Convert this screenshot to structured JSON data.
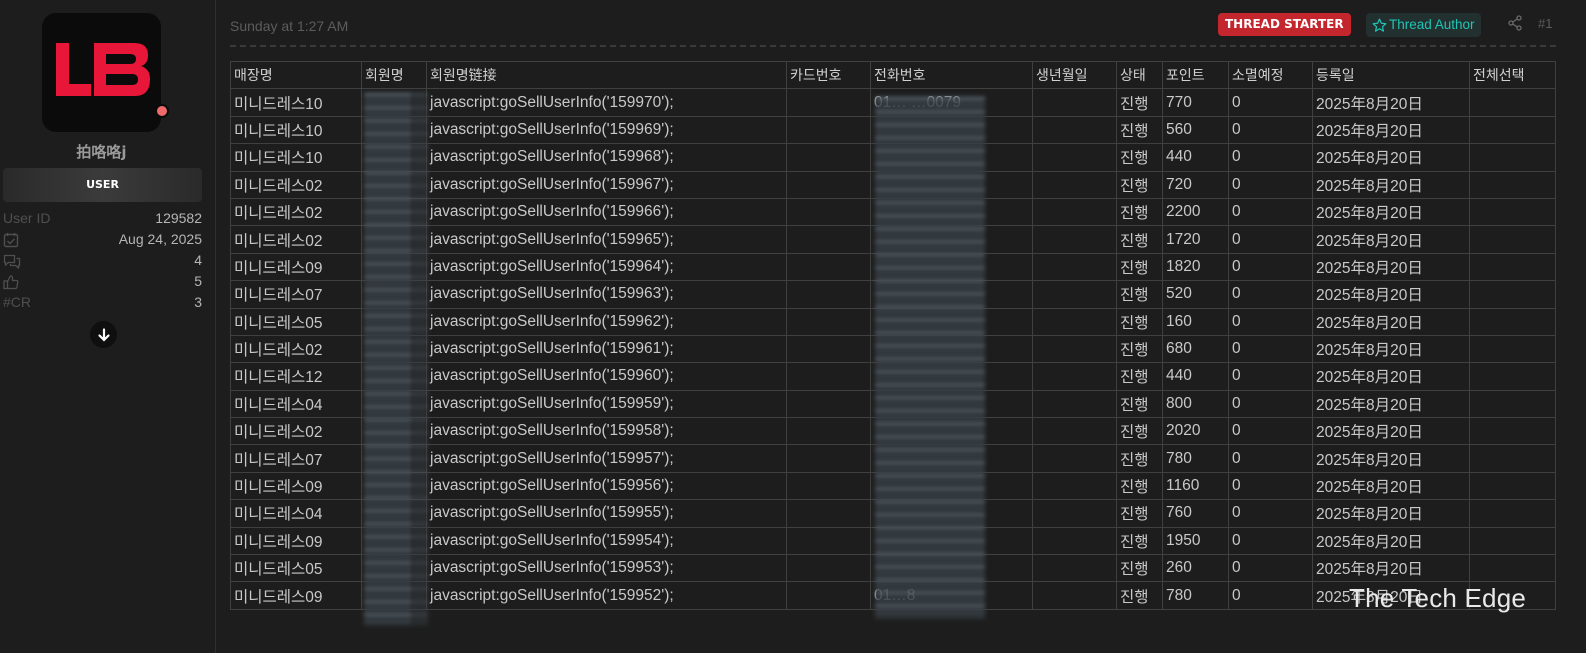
{
  "sidebar": {
    "avatar_text": "LB",
    "username": "拍咯咯j",
    "role": "USER",
    "stats": [
      {
        "label": "User ID",
        "icon": "",
        "value": "129582"
      },
      {
        "label": "",
        "icon": "calendar-check-icon",
        "value": "Aug 24, 2025"
      },
      {
        "label": "",
        "icon": "messages-icon",
        "value": "4"
      },
      {
        "label": "",
        "icon": "thumbs-up-icon",
        "value": "5"
      },
      {
        "label": "#CR",
        "icon": "",
        "value": "3"
      }
    ],
    "expand_icon": "arrow-down-icon"
  },
  "post": {
    "date": "Sunday at 1:27 AM",
    "starter_badge": "THREAD STARTER",
    "author_badge": "Thread Author",
    "number": "#1"
  },
  "table": {
    "headers": [
      "매장명",
      "회원명",
      "회원명链接",
      "카드번호",
      "전화번호",
      "생년월일",
      "상태",
      "포인트",
      "소멸예정",
      "등록일",
      "전체선택"
    ],
    "rows": [
      {
        "store": "미니드레스10",
        "link": "javascript:goSellUserInfo('159970');",
        "phone": "01… …0079",
        "status": "진행",
        "points": "770",
        "expire": "0",
        "date": "2025年8月20日"
      },
      {
        "store": "미니드레스10",
        "link": "javascript:goSellUserInfo('159969');",
        "phone": "",
        "status": "진행",
        "points": "560",
        "expire": "0",
        "date": "2025年8月20日"
      },
      {
        "store": "미니드레스10",
        "link": "javascript:goSellUserInfo('159968');",
        "phone": "",
        "status": "진행",
        "points": "440",
        "expire": "0",
        "date": "2025年8月20日"
      },
      {
        "store": "미니드레스02",
        "link": "javascript:goSellUserInfo('159967');",
        "phone": "",
        "status": "진행",
        "points": "720",
        "expire": "0",
        "date": "2025年8月20日"
      },
      {
        "store": "미니드레스02",
        "link": "javascript:goSellUserInfo('159966');",
        "phone": "",
        "status": "진행",
        "points": "2200",
        "expire": "0",
        "date": "2025年8月20日"
      },
      {
        "store": "미니드레스02",
        "link": "javascript:goSellUserInfo('159965');",
        "phone": "",
        "status": "진행",
        "points": "1720",
        "expire": "0",
        "date": "2025年8月20日"
      },
      {
        "store": "미니드레스09",
        "link": "javascript:goSellUserInfo('159964');",
        "phone": "",
        "status": "진행",
        "points": "1820",
        "expire": "0",
        "date": "2025年8月20日"
      },
      {
        "store": "미니드레스07",
        "link": "javascript:goSellUserInfo('159963');",
        "phone": "",
        "status": "진행",
        "points": "520",
        "expire": "0",
        "date": "2025年8月20日"
      },
      {
        "store": "미니드레스05",
        "link": "javascript:goSellUserInfo('159962');",
        "phone": "",
        "status": "진행",
        "points": "160",
        "expire": "0",
        "date": "2025年8月20日"
      },
      {
        "store": "미니드레스02",
        "link": "javascript:goSellUserInfo('159961');",
        "phone": "",
        "status": "진행",
        "points": "680",
        "expire": "0",
        "date": "2025年8月20日"
      },
      {
        "store": "미니드레스12",
        "link": "javascript:goSellUserInfo('159960');",
        "phone": "",
        "status": "진행",
        "points": "440",
        "expire": "0",
        "date": "2025年8月20日"
      },
      {
        "store": "미니드레스04",
        "link": "javascript:goSellUserInfo('159959');",
        "phone": "",
        "status": "진행",
        "points": "800",
        "expire": "0",
        "date": "2025年8月20日"
      },
      {
        "store": "미니드레스02",
        "link": "javascript:goSellUserInfo('159958');",
        "phone": "",
        "status": "진행",
        "points": "2020",
        "expire": "0",
        "date": "2025年8月20日"
      },
      {
        "store": "미니드레스07",
        "link": "javascript:goSellUserInfo('159957');",
        "phone": "",
        "status": "진행",
        "points": "780",
        "expire": "0",
        "date": "2025年8月20日"
      },
      {
        "store": "미니드레스09",
        "link": "javascript:goSellUserInfo('159956');",
        "phone": "",
        "status": "진행",
        "points": "1160",
        "expire": "0",
        "date": "2025年8月20日"
      },
      {
        "store": "미니드레스04",
        "link": "javascript:goSellUserInfo('159955');",
        "phone": "",
        "status": "진행",
        "points": "760",
        "expire": "0",
        "date": "2025年8月20日"
      },
      {
        "store": "미니드레스09",
        "link": "javascript:goSellUserInfo('159954');",
        "phone": "",
        "status": "진행",
        "points": "1950",
        "expire": "0",
        "date": "2025年8月20日"
      },
      {
        "store": "미니드레스05",
        "link": "javascript:goSellUserInfo('159953');",
        "phone": "",
        "status": "진행",
        "points": "260",
        "expire": "0",
        "date": "2025年8月20日"
      },
      {
        "store": "미니드레스09",
        "link": "javascript:goSellUserInfo('159952');",
        "phone": "01…8",
        "status": "진행",
        "points": "780",
        "expire": "0",
        "date": "2025年8月20日"
      }
    ]
  },
  "watermark": "The Tech Edge",
  "colors": {
    "brand_red": "#e8173a",
    "starter_red": "#c4262e",
    "author_teal": "#20c4b4",
    "status_dot": "#f06a6a"
  }
}
